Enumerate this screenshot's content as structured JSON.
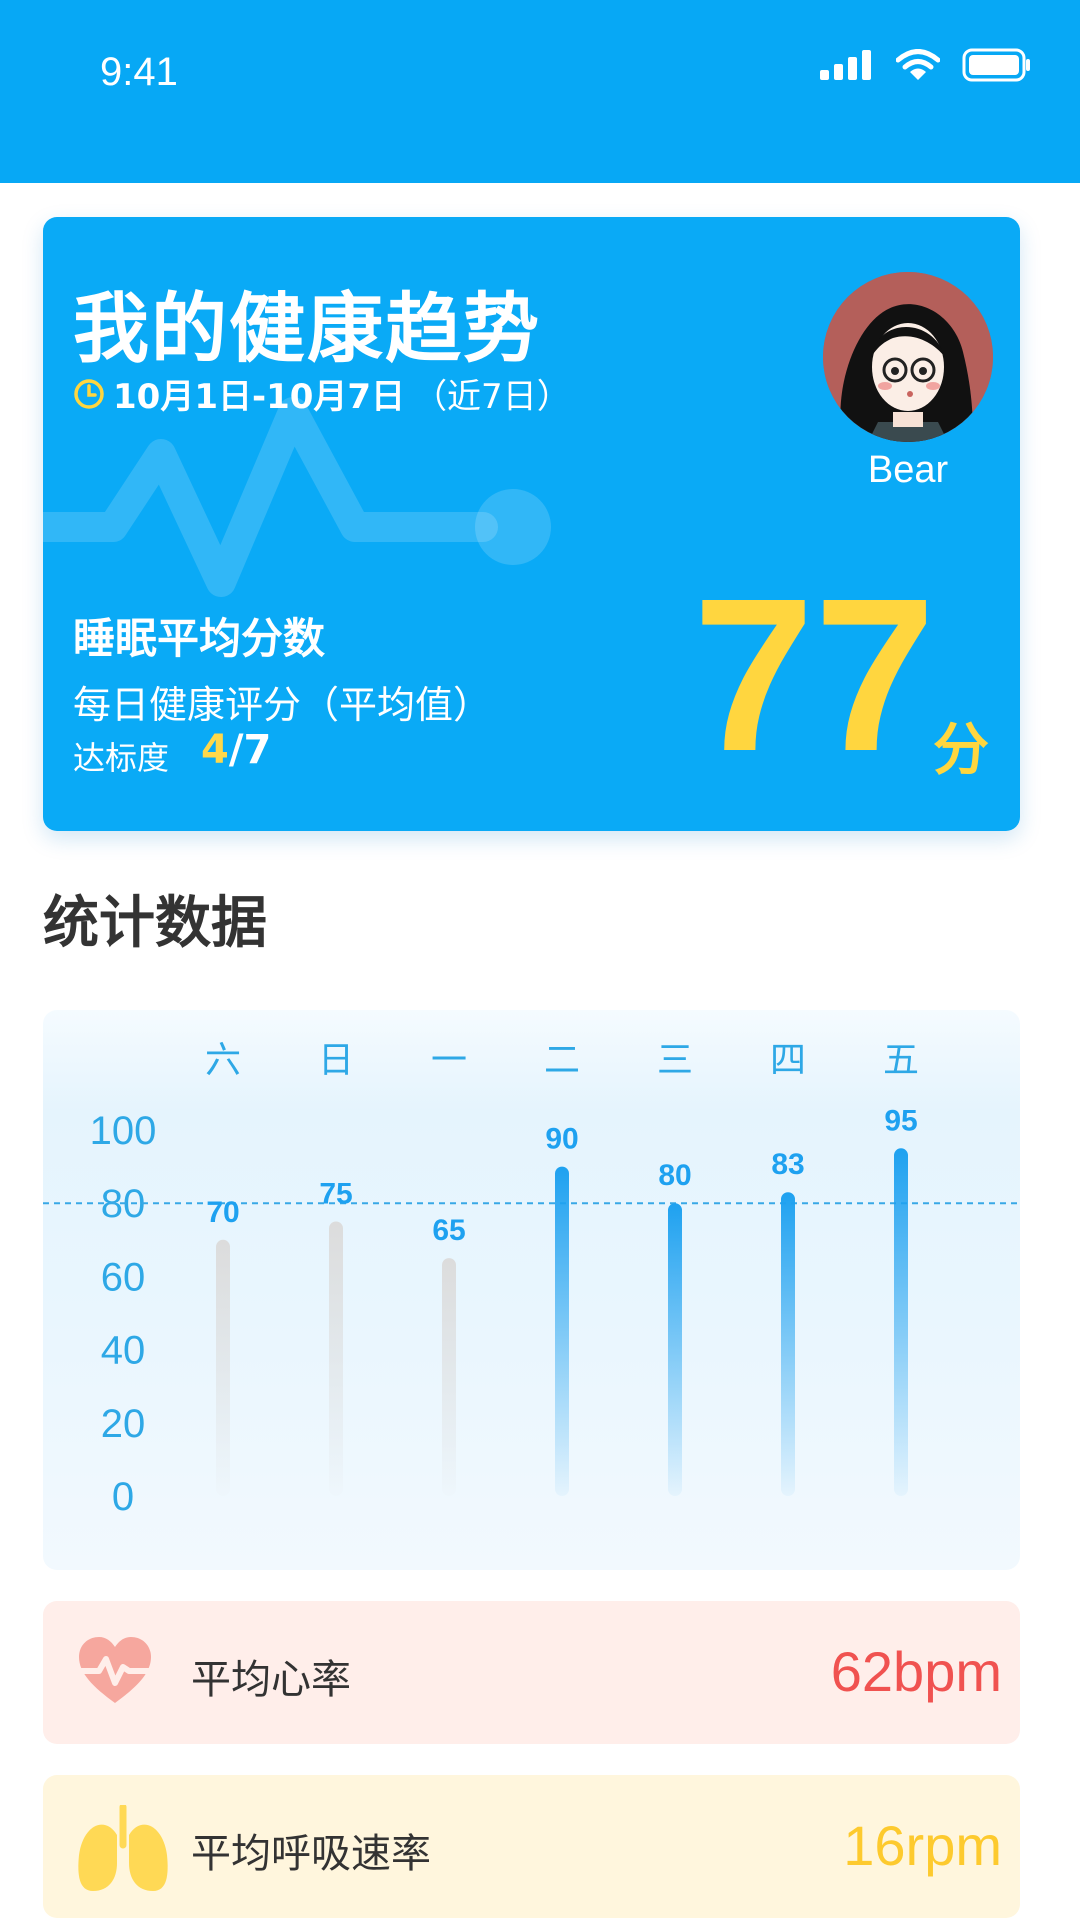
{
  "status_bar": {
    "time": "9:41"
  },
  "hero": {
    "title": "我的健康趋势",
    "date_range": "10月1日-10月7日",
    "date_recent": "（近7日）",
    "user_name": "Bear",
    "sleep_label": "睡眠平均分数",
    "daily_label": "每日健康评分（平均值）",
    "ratio_label": "达标度",
    "ratio_achieved": "4",
    "ratio_total": "/7",
    "score": "77",
    "score_unit": "分"
  },
  "section": {
    "title": "统计数据"
  },
  "chart_data": {
    "type": "bar",
    "categories": [
      "六",
      "日",
      "一",
      "二",
      "三",
      "四",
      "五"
    ],
    "values": [
      70,
      75,
      65,
      90,
      80,
      83,
      95
    ],
    "value_labels": [
      "70",
      "75",
      "65",
      "90",
      "80",
      "83",
      "95"
    ],
    "achieved": [
      false,
      false,
      false,
      true,
      true,
      true,
      true
    ],
    "y_ticks": [
      "100",
      "80",
      "60",
      "40",
      "20",
      "0"
    ],
    "ylim": [
      0,
      100
    ],
    "reference_line": 80,
    "colors": {
      "achieved": "#1ea1f0",
      "missed": "#dcdcdc",
      "axis_text": "#2ea8e6"
    }
  },
  "stats": {
    "heart_rate": {
      "label": "平均心率",
      "value": "62bpm",
      "icon": "heart-pulse-icon"
    },
    "respiration": {
      "label": "平均呼吸速率",
      "value": "16rpm",
      "icon": "lungs-icon"
    }
  },
  "colors": {
    "primary": "#0aaaf6",
    "score_yellow": "#ffd63f",
    "heart_red": "#f05250",
    "resp_yellow": "#fdca2e"
  }
}
